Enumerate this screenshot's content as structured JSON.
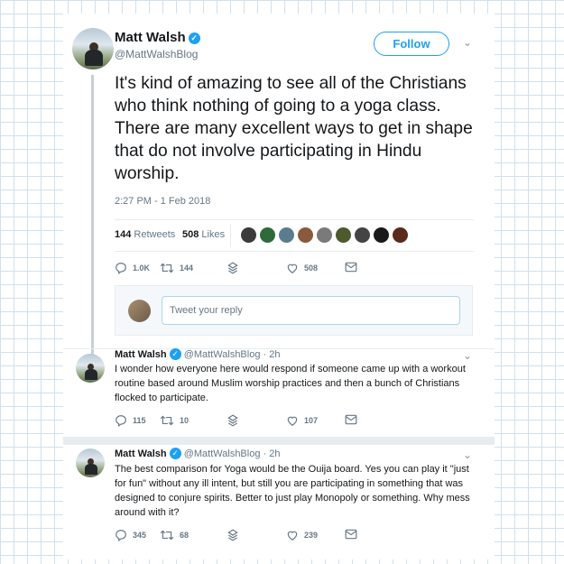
{
  "main_tweet": {
    "display_name": "Matt Walsh",
    "handle": "@MattWalshBlog",
    "follow_label": "Follow",
    "text": "It's kind of amazing to see all of the Christians who think nothing of going to a yoga class. There are many excellent ways to get in shape that do not involve participating in Hindu worship.",
    "timestamp": "2:27 PM - 1 Feb 2018",
    "retweets_count": "144",
    "retweets_label": "Retweets",
    "likes_count": "508",
    "likes_label": "Likes",
    "actions": {
      "replies": "1.0K",
      "retweets": "144",
      "likes": "508"
    }
  },
  "liker_avatar_colors": [
    "#3b3b3b",
    "#2f6b3a",
    "#5a7c8e",
    "#8a5a3c",
    "#7a7a7a",
    "#4c5a2e",
    "#444444",
    "#1a1a1a",
    "#5b2a1a"
  ],
  "reply_box": {
    "placeholder": "Tweet your reply"
  },
  "replies": [
    {
      "display_name": "Matt Walsh",
      "handle": "@MattWalshBlog",
      "time": "2h",
      "text": "I wonder how everyone here would respond if someone came up with a workout routine based around Muslim worship practices and then a bunch of Christians flocked to participate.",
      "actions": {
        "replies": "115",
        "retweets": "10",
        "likes": "107"
      }
    },
    {
      "display_name": "Matt Walsh",
      "handle": "@MattWalshBlog",
      "time": "2h",
      "text": "The best comparison for Yoga would be the Ouija board. Yes you can play it \"just for fun\" without any ill intent, but still you are participating in something that was designed to conjure spirits. Better to just play Monopoly or something. Why mess around with it?",
      "actions": {
        "replies": "345",
        "retweets": "68",
        "likes": "239"
      }
    }
  ],
  "colors": {
    "accent": "#1da1f2",
    "text": "#14171a",
    "muted": "#657786",
    "border": "#e6ecf0",
    "thread_line": "#c4cfd6",
    "grid": "#cfe0ee"
  },
  "icons": [
    "verified-icon",
    "chevron-down-icon",
    "reply-icon",
    "retweet-icon",
    "share-icon",
    "like-icon",
    "message-icon"
  ]
}
